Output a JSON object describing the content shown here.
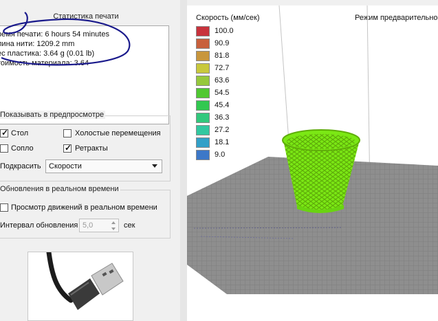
{
  "stats": {
    "title": "Статистика печати",
    "lines": [
      "ремя печати: 6 hours 54 minutes",
      "лина нити: 1209.2 mm",
      "ес пластика: 3.64 g (0.01 lb)",
      "тоимость материала: 3.64"
    ]
  },
  "preview": {
    "title": "Показывать в предпросмотре",
    "table_label": "Стол",
    "table_checked": true,
    "travel_label": "Холостые перемещения",
    "travel_checked": false,
    "nozzle_label": "Сопло",
    "nozzle_checked": false,
    "retracts_label": "Ретракты",
    "retracts_checked": true,
    "color_label": "Подкрасить",
    "color_value": "Скорости"
  },
  "realtime": {
    "title": "Обновления в реальном времени",
    "moves_label": "Просмотр движений в реальном времени",
    "moves_checked": false,
    "interval_label": "Интервал обновления",
    "interval_value": "5,0",
    "interval_unit": "сек"
  },
  "viewport": {
    "legend_title": "Скорость (мм/сек)",
    "mode_title": "Режим предварительно",
    "legend": [
      {
        "value": "100.0",
        "color": "#c8323c"
      },
      {
        "value": "90.9",
        "color": "#c8603c"
      },
      {
        "value": "81.8",
        "color": "#c8963c"
      },
      {
        "value": "72.7",
        "color": "#c8c83c"
      },
      {
        "value": "63.6",
        "color": "#96c83c"
      },
      {
        "value": "54.5",
        "color": "#50c832"
      },
      {
        "value": "45.4",
        "color": "#32c850"
      },
      {
        "value": "36.3",
        "color": "#32c87d"
      },
      {
        "value": "27.2",
        "color": "#32c8a0"
      },
      {
        "value": "18.1",
        "color": "#32a0c8"
      },
      {
        "value": "9.0",
        "color": "#3c78c8"
      }
    ],
    "model_color": "#7be814"
  }
}
